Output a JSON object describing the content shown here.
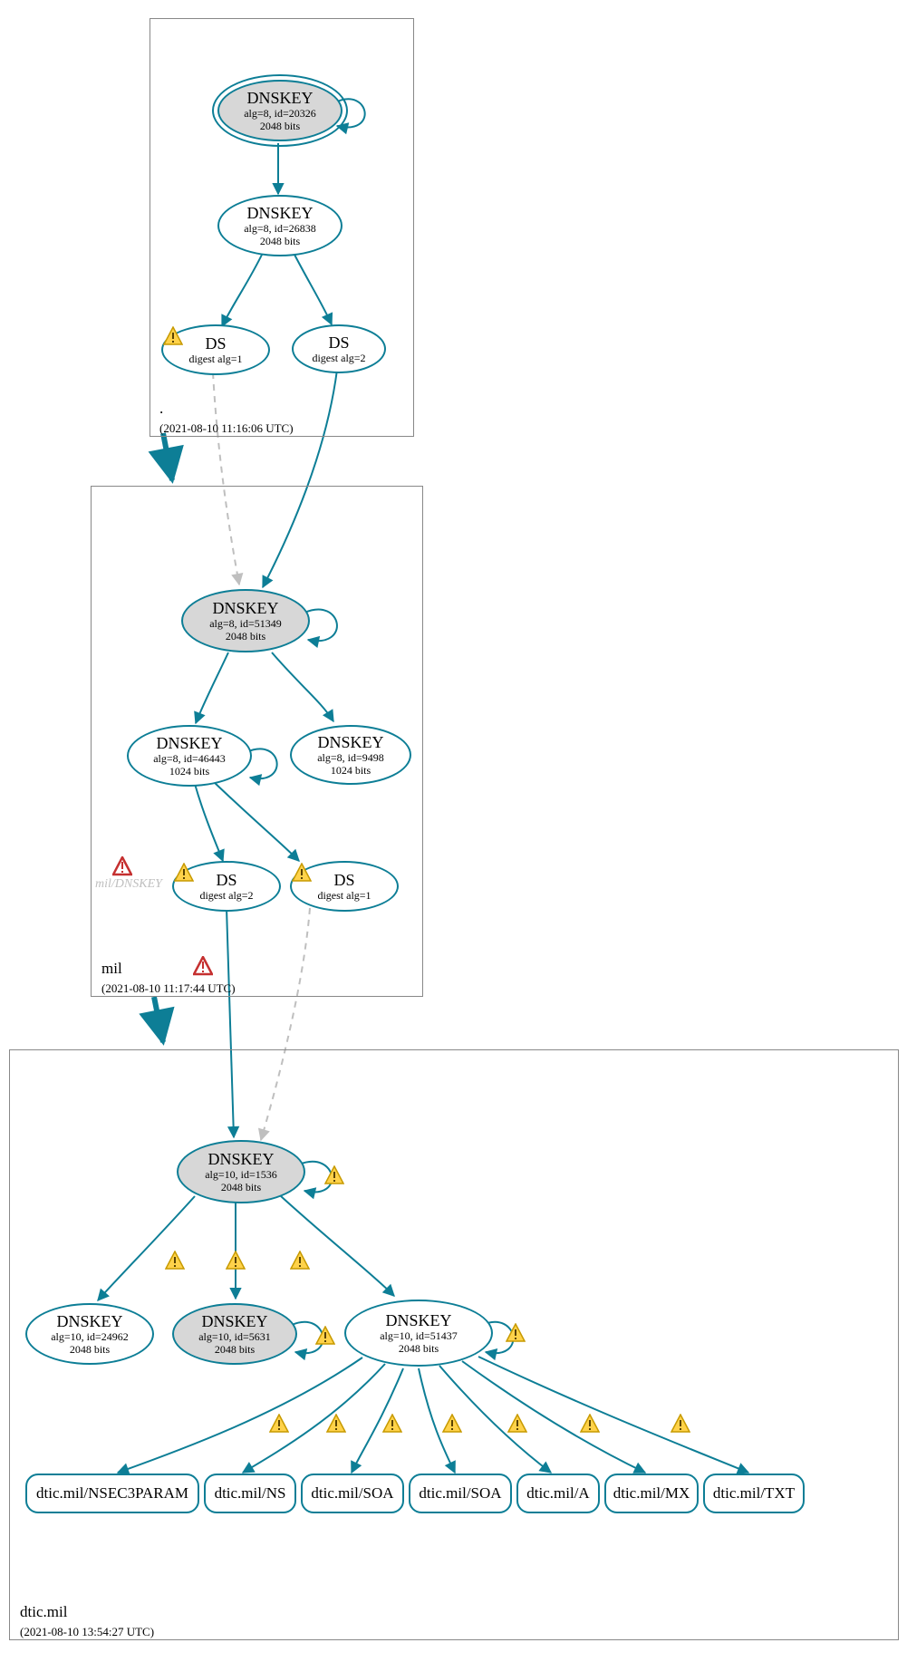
{
  "colors": {
    "stroke": "#0d7e96",
    "node_fill": "#d7d7d7",
    "box": "#888"
  },
  "zones": {
    "root": {
      "label": ".",
      "timestamp": "(2021-08-10 11:16:06 UTC)"
    },
    "mil": {
      "label": "mil",
      "timestamp": "(2021-08-10 11:17:44 UTC)"
    },
    "dtic": {
      "label": "dtic.mil",
      "timestamp": "(2021-08-10 13:54:27 UTC)"
    }
  },
  "nodes": {
    "root_ksk": {
      "title": "DNSKEY",
      "sub1": "alg=8, id=20326",
      "sub2": "2048 bits"
    },
    "root_zsk": {
      "title": "DNSKEY",
      "sub1": "alg=8, id=26838",
      "sub2": "2048 bits"
    },
    "root_ds1": {
      "title": "DS",
      "sub1": "digest alg=1",
      "warn": true
    },
    "root_ds2": {
      "title": "DS",
      "sub1": "digest alg=2"
    },
    "mil_ksk": {
      "title": "DNSKEY",
      "sub1": "alg=8, id=51349",
      "sub2": "2048 bits"
    },
    "mil_zsk1": {
      "title": "DNSKEY",
      "sub1": "alg=8, id=46443",
      "sub2": "1024 bits"
    },
    "mil_zsk2": {
      "title": "DNSKEY",
      "sub1": "alg=8, id=9498",
      "sub2": "1024 bits"
    },
    "mil_ds1": {
      "title": "DS",
      "sub1": "digest alg=2",
      "warn": true
    },
    "mil_ds2": {
      "title": "DS",
      "sub1": "digest alg=1",
      "warn": true
    },
    "mil_ghost": {
      "label": "mil/DNSKEY"
    },
    "dtic_ksk": {
      "title": "DNSKEY",
      "sub1": "alg=10, id=1536",
      "sub2": "2048 bits"
    },
    "dtic_k2": {
      "title": "DNSKEY",
      "sub1": "alg=10, id=24962",
      "sub2": "2048 bits"
    },
    "dtic_k3": {
      "title": "DNSKEY",
      "sub1": "alg=10, id=5631",
      "sub2": "2048 bits"
    },
    "dtic_k4": {
      "title": "DNSKEY",
      "sub1": "alg=10, id=51437",
      "sub2": "2048 bits"
    }
  },
  "rrsets": {
    "r1": "dtic.mil/NSEC3PARAM",
    "r2": "dtic.mil/NS",
    "r3": "dtic.mil/SOA",
    "r4": "dtic.mil/SOA",
    "r5": "dtic.mil/A",
    "r6": "dtic.mil/MX",
    "r7": "dtic.mil/TXT"
  }
}
